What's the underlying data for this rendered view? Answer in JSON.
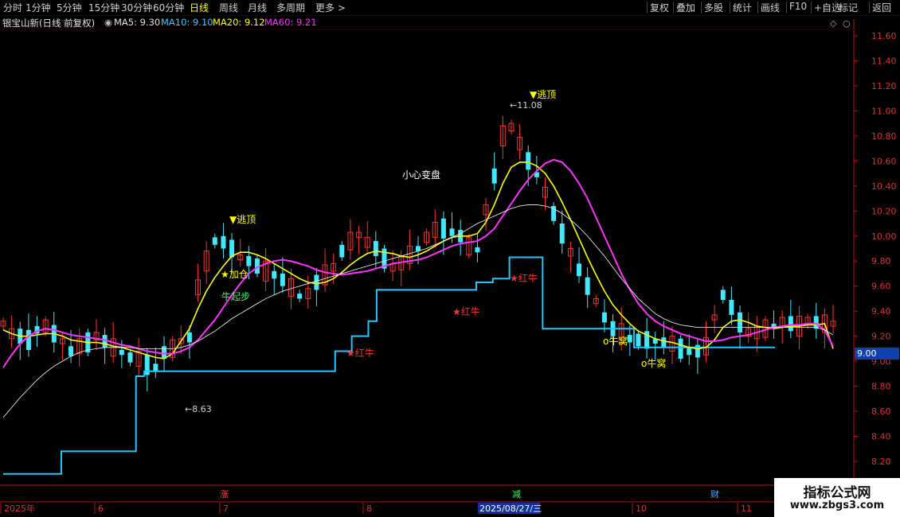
{
  "toolbar": {
    "periods": [
      "分时",
      "1分钟",
      "5分钟",
      "15分钟",
      "30分钟",
      "60分钟",
      "日线",
      "周线",
      "月线",
      "多周期",
      "更多 >"
    ],
    "active_period": "日线",
    "right_buttons": [
      "复权",
      "叠加",
      "多股",
      "统计",
      "画线",
      "F10",
      "+自选",
      "标记",
      "返回"
    ]
  },
  "info": {
    "stock_title": "银宝山新(日线 前复权)",
    "ma5": "MA5: 9.30",
    "ma10": "MA10: 9.10",
    "ma20": "MA20: 9.12",
    "ma60": "MA60: 9.21"
  },
  "colors": {
    "up": "#ff3030",
    "down": "#40e8ff",
    "ma5": "#ffffff",
    "ma10": "#ffff00",
    "ma20": "#ff30ff",
    "ma60": "#ffffff",
    "support": "#20c8ff",
    "axis": "#c01010"
  },
  "current_price": "9.00",
  "watermark": {
    "title": "指标公式网",
    "url": "www.zbgs3.com"
  },
  "chart_data": {
    "type": "candlestick",
    "ylim": [
      8.1,
      11.7
    ],
    "y_ticks": [
      "11.60",
      "11.40",
      "11.20",
      "11.00",
      "10.80",
      "10.60",
      "10.40",
      "10.20",
      "10.00",
      "9.80",
      "9.60",
      "9.40",
      "9.20",
      "9.00",
      "8.80",
      "8.60",
      "8.40",
      "8.20"
    ],
    "x_labels": [
      "2025年",
      "6",
      "7",
      "8",
      "2025/08/27/三",
      "10",
      "11"
    ],
    "markers_bottom": [
      "涨",
      "减",
      "财"
    ],
    "annotations": {
      "low": "8.63",
      "high": "11.08",
      "escape_top_1": "▼逃顶",
      "escape_top_2": "▼逃顶",
      "add_position": "★加仓",
      "bull_start": "牛起步",
      "careful": "小心变盘",
      "red_bull_1": "★红牛",
      "red_bull_2": "★红牛",
      "red_bull_3": "★红牛",
      "bull_nest_1": "o牛窝",
      "bull_nest_2": "o牛窝"
    },
    "series": [
      {
        "name": "MA5",
        "values": [
          9.3,
          9.22,
          9.2,
          9.17,
          9.25,
          9.28,
          9.22,
          9.16,
          9.08,
          9.12,
          9.15,
          9.2,
          9.16,
          9.11,
          9.07,
          9.03,
          9.02,
          8.97,
          8.95,
          9.07,
          9.1,
          9.16,
          9.19,
          9.59,
          9.8,
          9.96,
          9.95,
          9.9,
          9.83,
          9.8,
          9.76,
          9.72,
          9.69,
          9.65,
          9.59,
          9.52,
          9.54,
          9.63,
          9.69,
          9.75,
          9.88,
          9.96,
          10.01,
          9.95,
          9.9,
          9.82,
          9.75,
          9.78,
          9.85,
          9.9,
          9.99,
          10.05,
          10.06,
          10.03,
          10.0,
          9.92,
          9.89,
          10.21,
          10.48,
          10.8,
          10.87,
          10.74,
          10.6,
          10.49,
          10.35,
          10.18,
          10.02,
          9.87,
          9.73,
          9.6,
          9.48,
          9.35,
          9.26,
          9.22,
          9.18,
          9.17,
          9.17,
          9.16,
          9.15,
          9.14,
          9.1,
          9.08,
          9.08,
          9.12,
          9.35,
          9.53,
          9.43,
          9.31,
          9.23,
          9.23,
          9.26,
          9.28,
          9.31,
          9.3,
          9.28,
          9.32,
          9.31,
          9.3,
          9.3
        ]
      },
      {
        "name": "MA10",
        "values": [
          9.25,
          9.22,
          9.2,
          9.2,
          9.21,
          9.22,
          9.22,
          9.2,
          9.17,
          9.16,
          9.15,
          9.15,
          9.14,
          9.12,
          9.11,
          9.09,
          9.07,
          9.05,
          9.03,
          9.02,
          9.06,
          9.16,
          9.26,
          9.42,
          9.56,
          9.67,
          9.76,
          9.84,
          9.87,
          9.87,
          9.85,
          9.82,
          9.78,
          9.74,
          9.7,
          9.66,
          9.63,
          9.62,
          9.63,
          9.66,
          9.71,
          9.77,
          9.82,
          9.86,
          9.88,
          9.87,
          9.86,
          9.84,
          9.83,
          9.85,
          9.88,
          9.92,
          9.96,
          9.99,
          10.0,
          10.0,
          10.02,
          10.11,
          10.25,
          10.42,
          10.55,
          10.59,
          10.59,
          10.56,
          10.5,
          10.4,
          10.27,
          10.13,
          9.98,
          9.83,
          9.69,
          9.56,
          9.45,
          9.37,
          9.3,
          9.24,
          9.21,
          9.18,
          9.16,
          9.15,
          9.13,
          9.11,
          9.1,
          9.11,
          9.17,
          9.27,
          9.32,
          9.33,
          9.31,
          9.28,
          9.27,
          9.26,
          9.27,
          9.28,
          9.28,
          9.29,
          9.29,
          9.3,
          9.1
        ]
      },
      {
        "name": "MA20",
        "values": [
          8.95,
          9.05,
          9.14,
          9.2,
          9.24,
          9.26,
          9.25,
          9.23,
          9.21,
          9.2,
          9.19,
          9.18,
          9.17,
          9.15,
          9.13,
          9.12,
          9.1,
          9.08,
          9.07,
          9.06,
          9.06,
          9.08,
          9.11,
          9.17,
          9.25,
          9.33,
          9.43,
          9.53,
          9.62,
          9.7,
          9.75,
          9.78,
          9.8,
          9.81,
          9.8,
          9.78,
          9.76,
          9.73,
          9.71,
          9.7,
          9.69,
          9.7,
          9.71,
          9.72,
          9.74,
          9.76,
          9.78,
          9.79,
          9.8,
          9.81,
          9.83,
          9.86,
          9.89,
          9.92,
          9.94,
          9.95,
          9.96,
          10.0,
          10.06,
          10.16,
          10.26,
          10.36,
          10.45,
          10.52,
          10.58,
          10.61,
          10.59,
          10.52,
          10.42,
          10.3,
          10.15,
          10.0,
          9.85,
          9.7,
          9.57,
          9.46,
          9.38,
          9.32,
          9.28,
          9.25,
          9.22,
          9.2,
          9.18,
          9.16,
          9.16,
          9.17,
          9.19,
          9.2,
          9.21,
          9.23,
          9.25,
          9.27,
          9.28,
          9.29,
          9.29,
          9.3,
          9.3,
          9.25,
          9.12
        ]
      },
      {
        "name": "MA60",
        "values": [
          8.55,
          8.63,
          8.71,
          8.78,
          8.85,
          8.91,
          8.96,
          9.0,
          9.04,
          9.07,
          9.09,
          9.1,
          9.11,
          9.11,
          9.11,
          9.11,
          9.1,
          9.1,
          9.1,
          9.1,
          9.1,
          9.11,
          9.13,
          9.16,
          9.2,
          9.24,
          9.29,
          9.34,
          9.38,
          9.42,
          9.46,
          9.5,
          9.53,
          9.56,
          9.58,
          9.6,
          9.62,
          9.64,
          9.66,
          9.68,
          9.7,
          9.72,
          9.74,
          9.76,
          9.78,
          9.8,
          9.82,
          9.84,
          9.86,
          9.88,
          9.9,
          9.93,
          9.96,
          9.99,
          10.02,
          10.06,
          10.1,
          10.13,
          10.16,
          10.19,
          10.22,
          10.24,
          10.25,
          10.25,
          10.24,
          10.22,
          10.18,
          10.13,
          10.07,
          10.0,
          9.92,
          9.84,
          9.75,
          9.66,
          9.58,
          9.5,
          9.44,
          9.38,
          9.34,
          9.31,
          9.29,
          9.28,
          9.27,
          9.27,
          9.27,
          9.27,
          9.27,
          9.27,
          9.27,
          9.27,
          9.27,
          9.27,
          9.27,
          9.27,
          9.27,
          9.27,
          9.27,
          9.25,
          9.21
        ]
      }
    ],
    "support_line": {
      "name": "support",
      "x": [
        0,
        0.07,
        0.07,
        0.16,
        0.16,
        0.17,
        0.17,
        0.4,
        0.4,
        0.42,
        0.42,
        0.44,
        0.44,
        0.45,
        0.45,
        0.57,
        0.57,
        0.59,
        0.59,
        0.61,
        0.61,
        0.62,
        0.62,
        0.65,
        0.65,
        0.76,
        0.76,
        0.93
      ],
      "values": [
        8.1,
        8.1,
        8.28,
        8.28,
        8.88,
        8.88,
        8.92,
        8.92,
        9.08,
        9.08,
        9.2,
        9.2,
        9.32,
        9.32,
        9.57,
        9.57,
        9.63,
        9.63,
        9.66,
        9.66,
        9.83,
        9.83,
        9.83,
        9.83,
        9.26,
        9.26,
        9.11,
        9.11
      ]
    }
  }
}
